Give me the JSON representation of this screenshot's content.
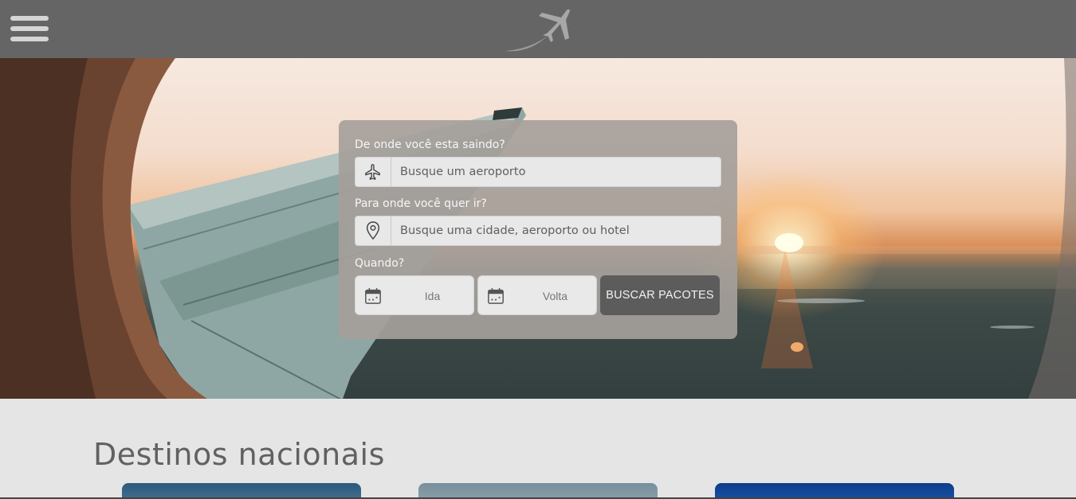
{
  "header": {
    "menu_icon": "hamburger-menu-icon",
    "logo_icon": "airplane-logo-icon"
  },
  "search": {
    "origin_label": "De onde você esta saindo?",
    "origin_placeholder": "Busque um aeroporto",
    "origin_icon": "airplane-icon",
    "destination_label": "Para onde você quer ir?",
    "destination_placeholder": "Busque uma cidade, aeroporto ou hotel",
    "destination_icon": "map-pin-icon",
    "when_label": "Quando?",
    "departure_label": "Ida",
    "return_label": "Volta",
    "calendar_icon": "calendar-icon",
    "submit_label": "BUSCAR PACOTES"
  },
  "destinations": {
    "title": "Destinos nacionais"
  },
  "colors": {
    "header_bg": "#656565",
    "card_bg": "#a5a09b",
    "button_bg": "#5c5c5c",
    "page_bg": "#e5e5e5"
  }
}
